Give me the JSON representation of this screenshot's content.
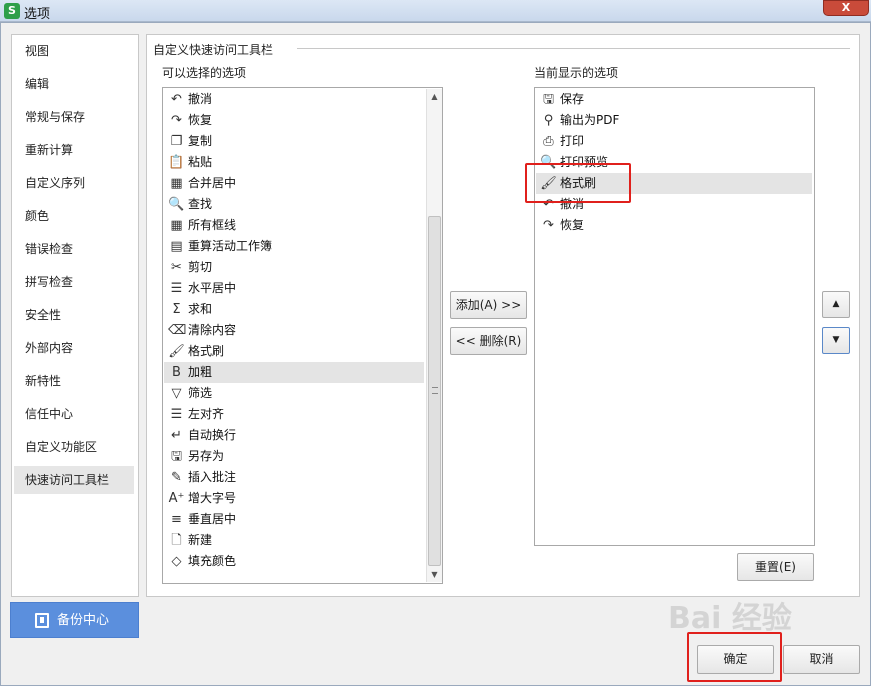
{
  "window": {
    "app_icon": "S",
    "title": "选项",
    "close_label": "X"
  },
  "sidebar": {
    "items": [
      {
        "label": "视图"
      },
      {
        "label": "编辑"
      },
      {
        "label": "常规与保存"
      },
      {
        "label": "重新计算"
      },
      {
        "label": "自定义序列"
      },
      {
        "label": "颜色"
      },
      {
        "label": "错误检查"
      },
      {
        "label": "拼写检查"
      },
      {
        "label": "安全性"
      },
      {
        "label": "外部内容"
      },
      {
        "label": "新特性"
      },
      {
        "label": "信任中心"
      },
      {
        "label": "自定义功能区"
      },
      {
        "label": "快速访问工具栏",
        "active": true
      }
    ],
    "backup_label": "备份中心"
  },
  "main": {
    "section_title": "自定义快速访问工具栏",
    "available_label": "可以选择的选项",
    "current_label": "当前显示的选项",
    "available_items": [
      {
        "label": "撤消",
        "icon": "↶"
      },
      {
        "label": "恢复",
        "icon": "↷"
      },
      {
        "label": "复制",
        "icon": "❐"
      },
      {
        "label": "粘贴",
        "icon": "📋"
      },
      {
        "label": "合并居中",
        "icon": "▦"
      },
      {
        "label": "查找",
        "icon": "🔍"
      },
      {
        "label": "所有框线",
        "icon": "▦"
      },
      {
        "label": "重算活动工作簿",
        "icon": "▤"
      },
      {
        "label": "剪切",
        "icon": "✂"
      },
      {
        "label": "水平居中",
        "icon": "☰"
      },
      {
        "label": "求和",
        "icon": "Σ"
      },
      {
        "label": "清除内容",
        "icon": "⌫"
      },
      {
        "label": "格式刷",
        "icon": "🖌"
      },
      {
        "label": "加粗",
        "icon": "B",
        "selected": true
      },
      {
        "label": "筛选",
        "icon": "▽"
      },
      {
        "label": "左对齐",
        "icon": "☰"
      },
      {
        "label": "自动换行",
        "icon": "↵"
      },
      {
        "label": "另存为",
        "icon": "🖫"
      },
      {
        "label": "插入批注",
        "icon": "✎"
      },
      {
        "label": "增大字号",
        "icon": "A⁺"
      },
      {
        "label": "垂直居中",
        "icon": "≡"
      },
      {
        "label": "新建",
        "icon": "🗋"
      },
      {
        "label": "填充颜色",
        "icon": "◇"
      }
    ],
    "current_items": [
      {
        "label": "保存",
        "icon": "🖫"
      },
      {
        "label": "输出为PDF",
        "icon": "⚲"
      },
      {
        "label": "打印",
        "icon": "⎙"
      },
      {
        "label": "打印预览",
        "icon": "🔍"
      },
      {
        "label": "格式刷",
        "icon": "🖌",
        "selected": true
      },
      {
        "label": "撤消",
        "icon": "↶"
      },
      {
        "label": "恢复",
        "icon": "↷"
      }
    ],
    "add_button": "添加(A) >>",
    "remove_button": "<< 删除(R)",
    "move_up": "▲",
    "move_down": "▼",
    "reset_button": "重置(E)",
    "scroll_up": "▲",
    "scroll_down": "▼"
  },
  "footer": {
    "ok_button": "确定",
    "cancel_button": "取消"
  },
  "watermark": "Bai 经验",
  "colors": {
    "highlight": "#e0201c",
    "backup": "#5b8fdd"
  }
}
